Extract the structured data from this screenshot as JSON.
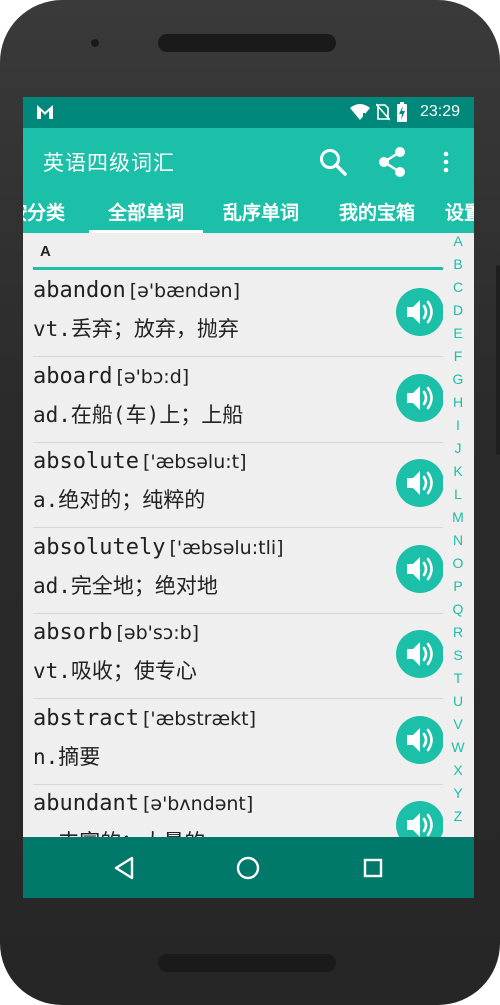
{
  "status_bar": {
    "time": "23:29",
    "icons": [
      "gmail-icon",
      "wifi-icon",
      "no-sim-icon",
      "battery-icon"
    ]
  },
  "app_bar": {
    "title": "英语四级词汇",
    "actions": [
      "search-icon",
      "share-icon",
      "more-vert-icon"
    ]
  },
  "tabs": [
    {
      "label": "按分类"
    },
    {
      "label": "全部单词",
      "selected": true
    },
    {
      "label": "乱序单词"
    },
    {
      "label": "我的宝箱"
    },
    {
      "label": "设置"
    }
  ],
  "section": {
    "letter": "A"
  },
  "words": [
    {
      "word": "abandon",
      "phonetic": "[ə'bændən]",
      "meaning": "vt.丢弃；放弃，抛弃"
    },
    {
      "word": "aboard",
      "phonetic": "[ə'bɔ:d]",
      "meaning": "ad.在船(车)上；上船"
    },
    {
      "word": "absolute",
      "phonetic": "['æbsəlu:t]",
      "meaning": "a.绝对的；纯粹的"
    },
    {
      "word": "absolutely",
      "phonetic": "['æbsəlu:tli]",
      "meaning": "ad.完全地；绝对地"
    },
    {
      "word": "absorb",
      "phonetic": "[əb'sɔ:b]",
      "meaning": "vt.吸收；使专心"
    },
    {
      "word": "abstract",
      "phonetic": "['æbstrækt]",
      "meaning": "n.摘要"
    },
    {
      "word": "abundant",
      "phonetic": "[ə'bʌndənt]",
      "meaning": "a.丰富的；大量的"
    }
  ],
  "alphabet_index": [
    "A",
    "B",
    "C",
    "D",
    "E",
    "F",
    "G",
    "H",
    "I",
    "J",
    "K",
    "L",
    "M",
    "N",
    "O",
    "P",
    "Q",
    "R",
    "S",
    "T",
    "U",
    "V",
    "W",
    "X",
    "Y",
    "Z"
  ],
  "nav_bar": [
    "back-icon",
    "home-icon",
    "recents-icon"
  ],
  "colors": {
    "accent": "#1cbfa8",
    "status_bar": "#00897b",
    "nav_bar": "#00796b",
    "list_bg": "#efefef"
  }
}
